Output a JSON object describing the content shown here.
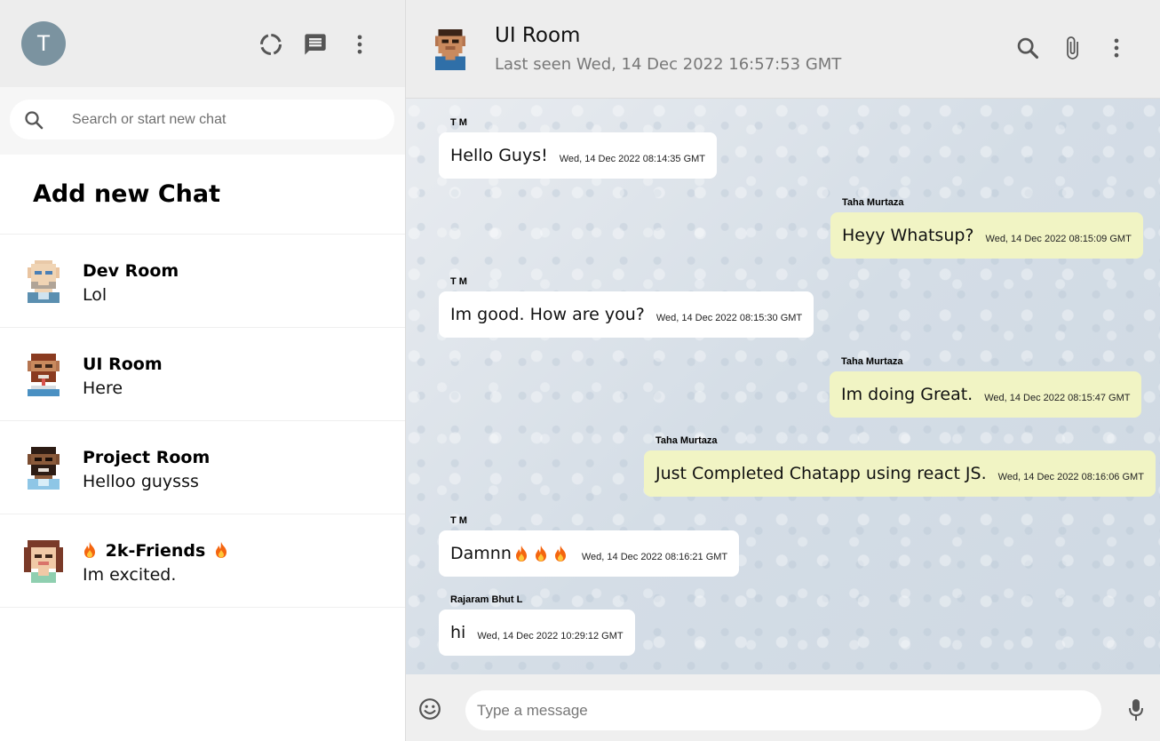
{
  "sidebar": {
    "avatar_letter": "T",
    "icons": [
      "status-icon",
      "new-chat-icon",
      "more-vert-icon"
    ],
    "search": {
      "placeholder": "Search or start new chat"
    },
    "add_new_chat": "Add new Chat",
    "chats": [
      {
        "name": "Dev Room",
        "last_message": "Lol",
        "avatar": "pixel-avatar-bald"
      },
      {
        "name": "UI Room",
        "last_message": "Here",
        "avatar": "pixel-avatar-red-hair"
      },
      {
        "name": "Project Room",
        "last_message": "Helloo guysss",
        "avatar": "pixel-avatar-dark-skin"
      },
      {
        "name": "2k-Friends",
        "last_message": "Im excited.",
        "avatar": "pixel-avatar-long-hair",
        "decorations": "fire-emoji"
      }
    ]
  },
  "chat": {
    "title": "UI Room",
    "last_seen": "Last seen Wed, 14 Dec 2022 16:57:53 GMT",
    "header_icons": [
      "search-icon",
      "attach-icon",
      "more-vert-icon"
    ],
    "messages": [
      {
        "sender": "T M",
        "text": "Hello Guys!",
        "time": "Wed, 14 Dec 2022 08:14:35 GMT",
        "mine": false
      },
      {
        "sender": "Taha Murtaza",
        "text": "Heyy Whatsup?",
        "time": "Wed, 14 Dec 2022 08:15:09 GMT",
        "mine": true
      },
      {
        "sender": "T M",
        "text": "Im good. How are you?",
        "time": "Wed, 14 Dec 2022 08:15:30 GMT",
        "mine": false
      },
      {
        "sender": "Taha Murtaza",
        "text": "Im doing Great.",
        "time": "Wed, 14 Dec 2022 08:15:47 GMT",
        "mine": true
      },
      {
        "sender": "Taha Murtaza",
        "text": "Just Completed Chatapp using react JS.",
        "time": "Wed, 14 Dec 2022 08:16:06 GMT",
        "mine": true
      },
      {
        "sender": "T M",
        "text": "Damnn",
        "time": "Wed, 14 Dec 2022 08:16:21 GMT",
        "mine": false,
        "emoji_suffix": "fire-emoji x3"
      },
      {
        "sender": "Rajaram Bhut L",
        "text": "hi",
        "time": "Wed, 14 Dec 2022 10:29:12 GMT",
        "mine": false
      }
    ],
    "composer": {
      "placeholder": "Type a message"
    }
  },
  "colors": {
    "header_bg": "#ededed",
    "own_bubble": "#f1f4c4",
    "other_bubble": "#ffffff",
    "avatar_bg": "#7b93a0",
    "icon_gray": "#555555"
  }
}
